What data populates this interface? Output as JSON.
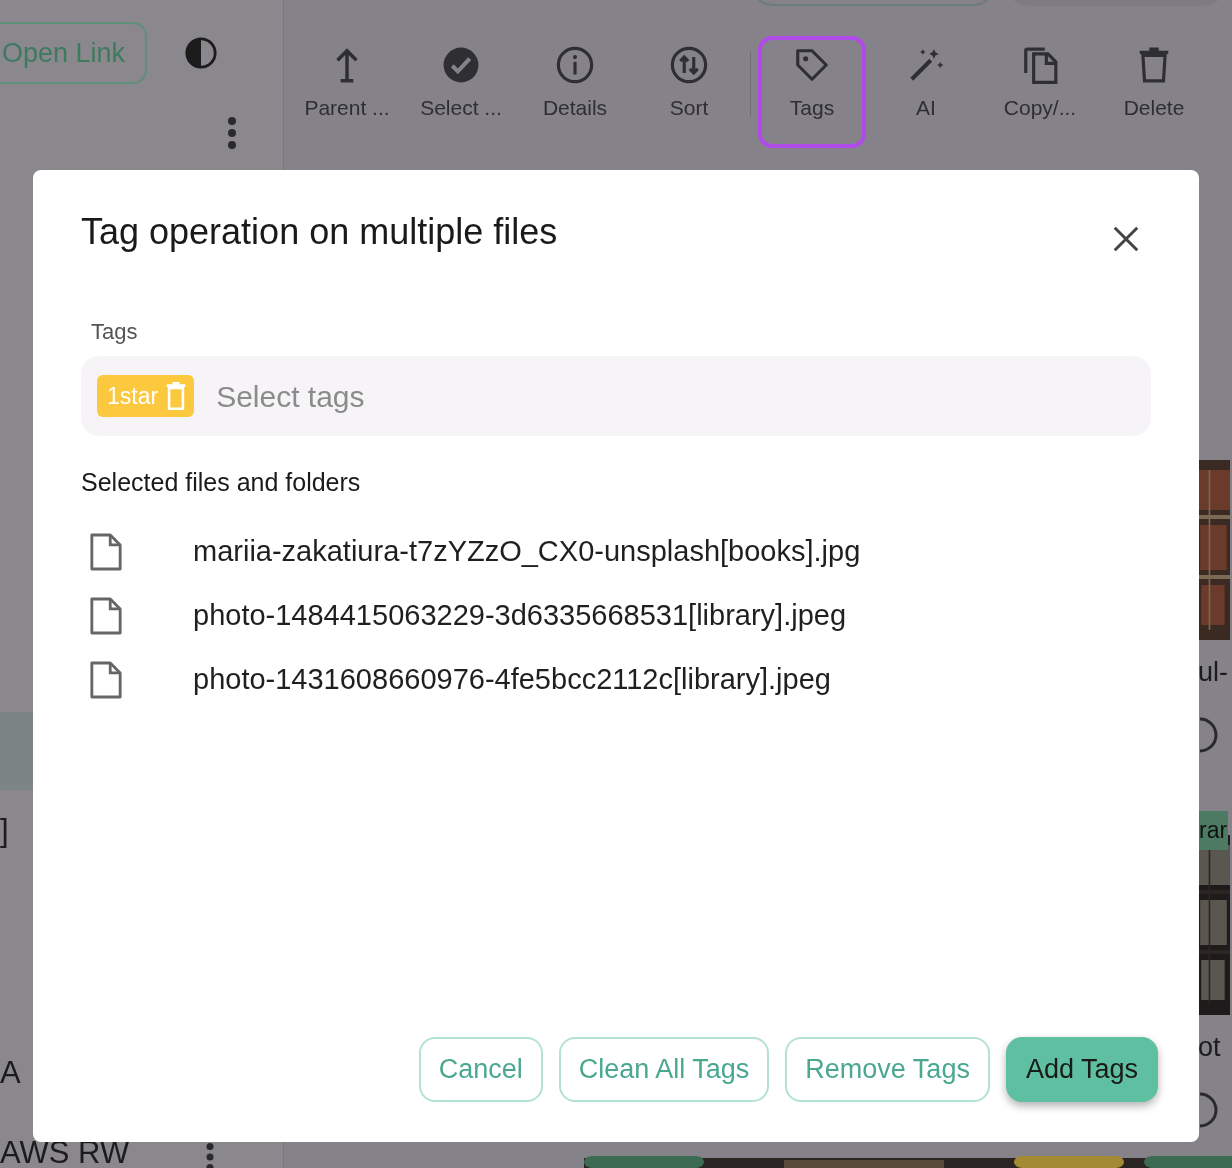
{
  "sidebar": {
    "open_link": "Open Link",
    "items": [
      {
        "selected": true
      },
      {
        "label": "]",
        "selected": false
      },
      {
        "label": "A",
        "selected": false
      },
      {
        "label": "AWS RW",
        "selected": false
      }
    ]
  },
  "toolbar": [
    {
      "label": "Parent ...",
      "highlighted": false
    },
    {
      "label": "Select ...",
      "highlighted": false
    },
    {
      "label": "Details",
      "highlighted": false
    },
    {
      "label": "Sort",
      "highlighted": false
    },
    {
      "label": "Tags",
      "highlighted": true
    },
    {
      "label": "AI",
      "highlighted": false
    },
    {
      "label": "Copy/...",
      "highlighted": false
    },
    {
      "label": "Delete",
      "highlighted": false
    }
  ],
  "grid": [
    {
      "caption": "ul-"
    },
    {
      "tag": "rar",
      "caption": "ot"
    }
  ],
  "dialog": {
    "title": "Tag operation on multiple files",
    "tags_label": "Tags",
    "chips": [
      {
        "label": "1star",
        "color": "#fcc83d"
      }
    ],
    "placeholder": "Select tags",
    "section": "Selected files and folders",
    "files": [
      "mariia-zakatiura-t7zYZzO_CX0-unsplash[books].jpg",
      "photo-1484415063229-3d6335668531[library].jpeg",
      "photo-1431608660976-4fe5bcc2112c[library].jpeg"
    ],
    "buttons": [
      {
        "label": "Cancel",
        "kind": "outline"
      },
      {
        "label": "Clean All Tags",
        "kind": "outline"
      },
      {
        "label": "Remove Tags",
        "kind": "outline"
      },
      {
        "label": "Add Tags",
        "kind": "primary"
      }
    ]
  }
}
